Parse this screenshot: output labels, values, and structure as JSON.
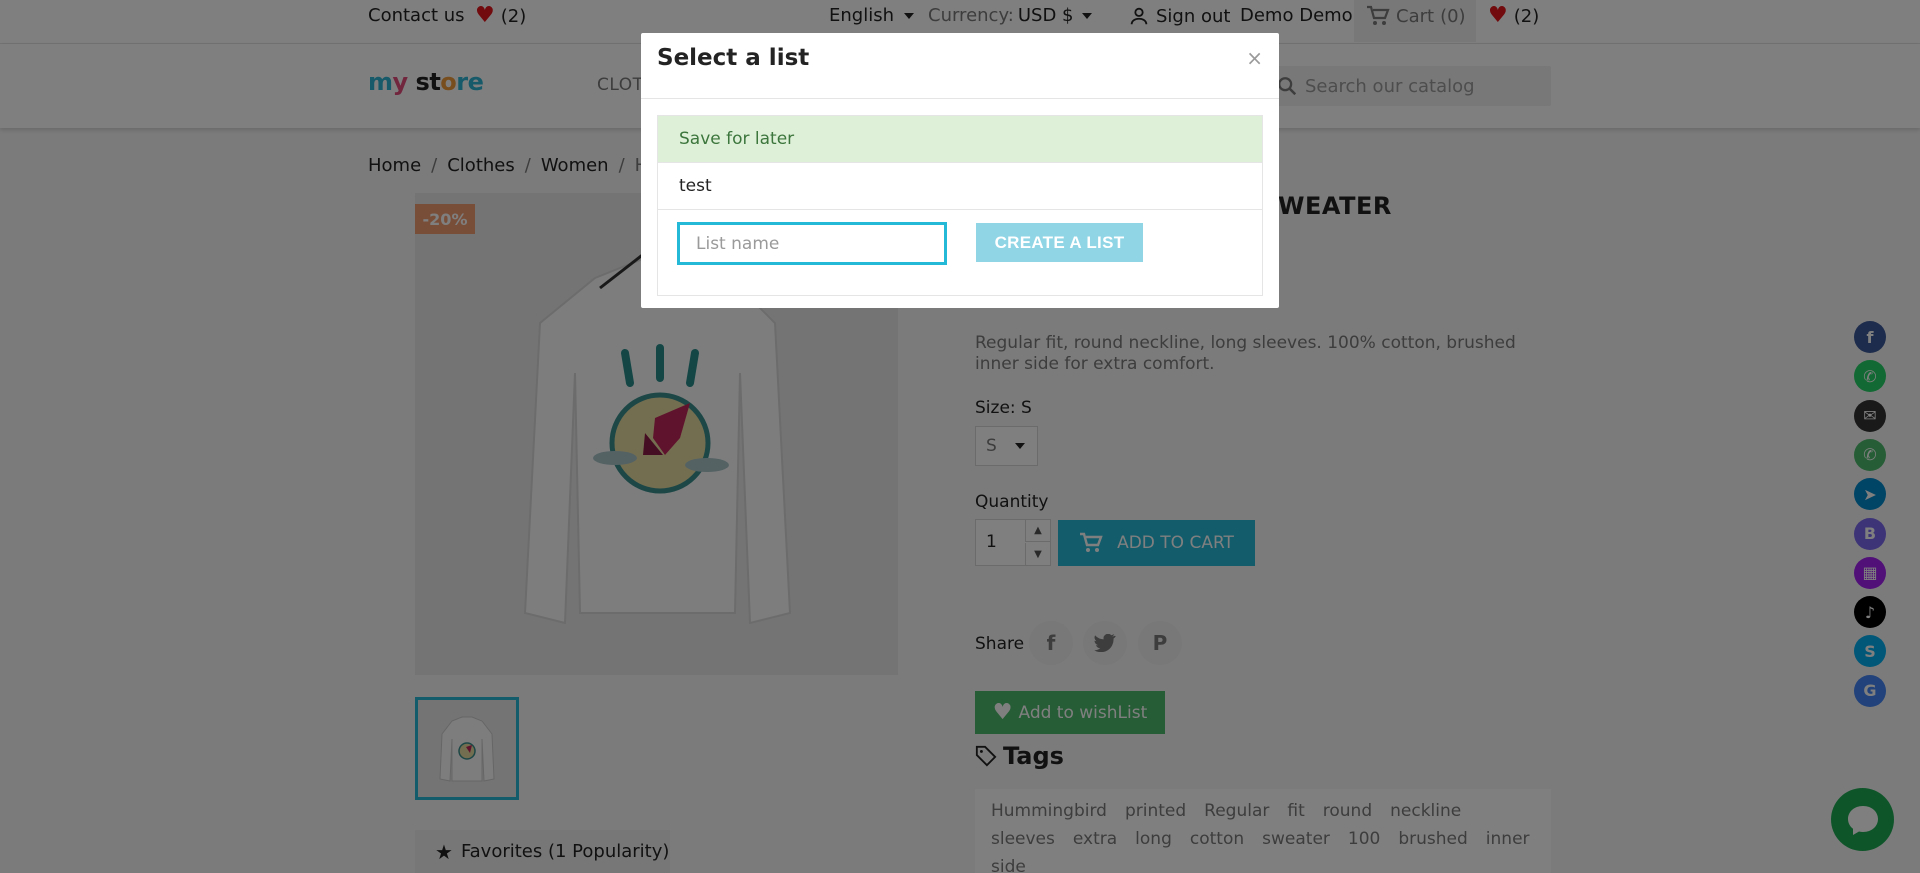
{
  "topbar": {
    "contact": "Contact us",
    "wishlist_count": "(2)",
    "language": "English",
    "currency_label": "Currency:",
    "currency_value": "USD $",
    "signout": "Sign out",
    "user": "Demo Demo",
    "cart": "Cart",
    "cart_count": "(0)",
    "wishlist_count_right": "(2)"
  },
  "header": {
    "logo": "my store",
    "nav_item": "CLOT",
    "search_placeholder": "Search our catalog"
  },
  "breadcrumb": [
    "Home",
    "Clothes",
    "Women",
    "Hu"
  ],
  "product": {
    "discount": "-20%",
    "title_fragment": "WEATER",
    "description": "Regular fit, round neckline, long sleeves. 100% cotton, brushed inner side for extra comfort.",
    "size_label": "Size: S",
    "size_value": "S",
    "quantity_label": "Quantity",
    "quantity": "1",
    "add_to_cart": "ADD TO CART",
    "share_label": "Share",
    "add_to_wishlist": "Add to wishList",
    "tags_title": "Tags",
    "tags": [
      "Hummingbird",
      "printed",
      "Regular",
      "fit",
      "round",
      "neckline",
      "sleeves",
      "extra",
      "long",
      "cotton",
      "sweater",
      "100",
      "brushed",
      "inner",
      "side"
    ],
    "favorites": "Favorites (1 Popularity)"
  },
  "social_icons": [
    {
      "name": "facebook-icon",
      "color": "#3b5998",
      "glyph": "f"
    },
    {
      "name": "whatsapp-icon",
      "color": "#25d366",
      "glyph": "✆"
    },
    {
      "name": "email-icon",
      "color": "#333333",
      "glyph": "✉"
    },
    {
      "name": "phone-icon",
      "color": "#4cbb6c",
      "glyph": "✆"
    },
    {
      "name": "telegram-icon",
      "color": "#0088cc",
      "glyph": "➤"
    },
    {
      "name": "b-icon",
      "color": "#7b68ee",
      "glyph": "B"
    },
    {
      "name": "qr-icon",
      "color": "#a020f0",
      "glyph": "▦"
    },
    {
      "name": "tiktok-icon",
      "color": "#000000",
      "glyph": "♪"
    },
    {
      "name": "skype-icon",
      "color": "#00aff0",
      "glyph": "S"
    },
    {
      "name": "google-icon",
      "color": "#4285f4",
      "glyph": "G"
    }
  ],
  "modal": {
    "title": "Select a list",
    "close": "×",
    "lists": [
      "Save for later",
      "test"
    ],
    "input_placeholder": "List name",
    "create_button": "CREATE A LIST"
  }
}
